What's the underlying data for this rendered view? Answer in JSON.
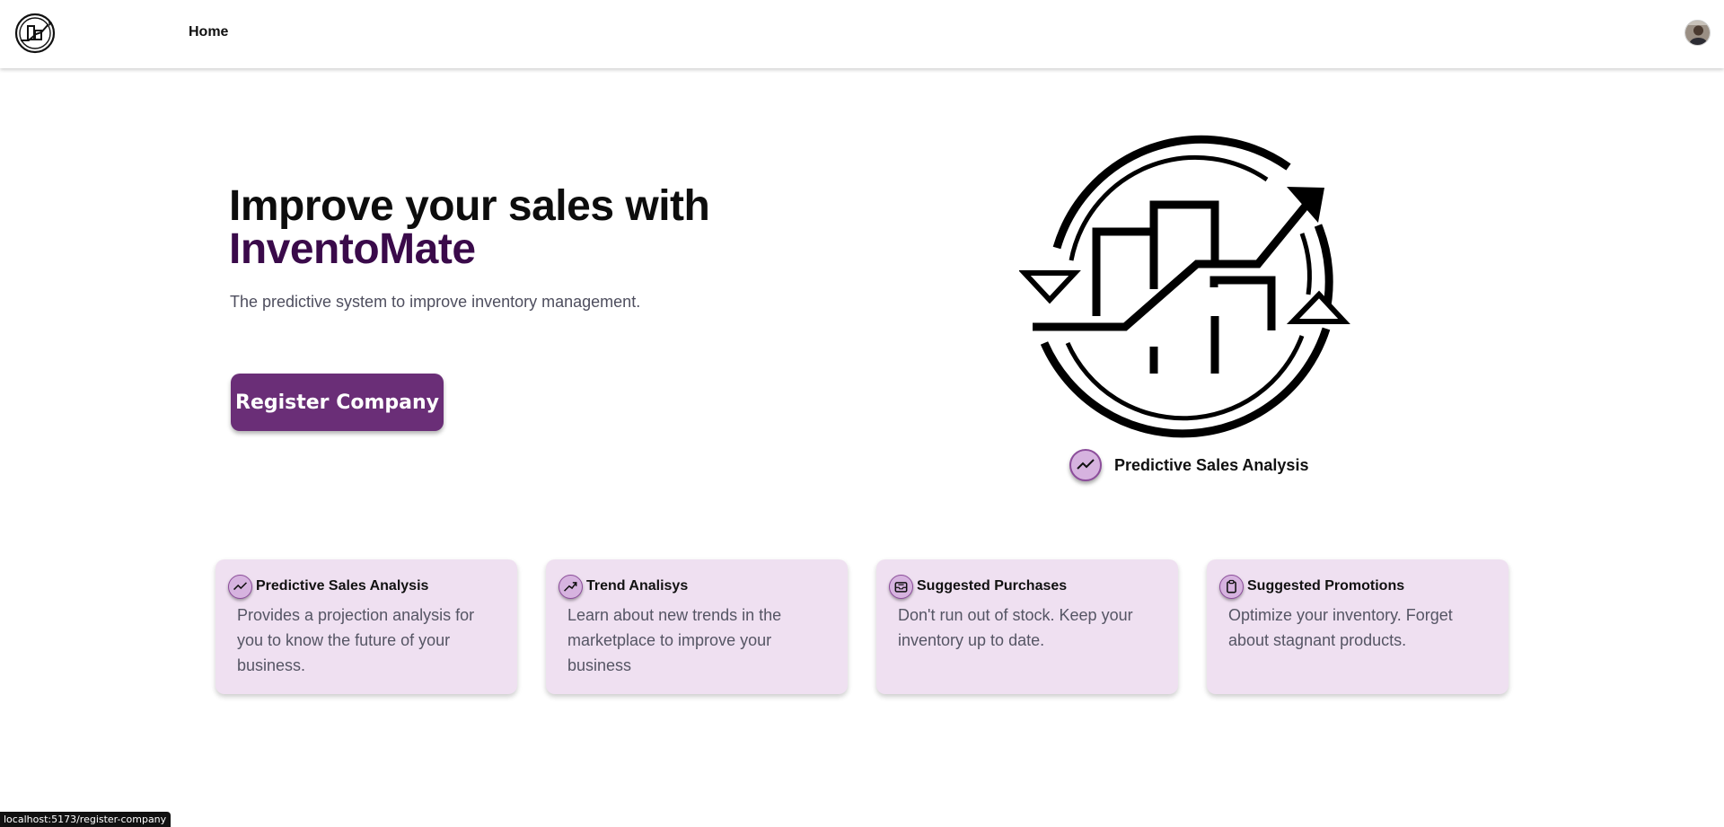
{
  "nav": {
    "logo_icon": "sales-circle-logo-icon",
    "home_label": "Home",
    "avatar_icon": "user-avatar-icon"
  },
  "hero": {
    "title_line1": "Improve your sales with",
    "title_line2": "InventoMate",
    "subtitle": "The predictive system to improve inventory management.",
    "register_label": "Register Company",
    "illustration_icon": "sales-growth-cycle-icon",
    "caption": "Predictive Sales Analysis",
    "caption_icon": "trend-line-icon"
  },
  "features": [
    {
      "icon": "trend-line-icon",
      "title": "Predictive Sales Analysis",
      "description": "Provides a projection analysis for you to know the future of your business."
    },
    {
      "icon": "trend-up-icon",
      "title": "Trend Analisys",
      "description": "Learn about new trends in the marketplace to improve your business"
    },
    {
      "icon": "inbox-icon",
      "title": "Suggested Purchases",
      "description": "Don't run out of stock. Keep your inventory up to date."
    },
    {
      "icon": "clipboard-icon",
      "title": "Suggested Promotions",
      "description": "Optimize your inventory. Forget about stagnant products."
    }
  ],
  "status_bar": {
    "url": "localhost:5173/register-company"
  },
  "colors": {
    "brand": "#3a0a4a",
    "button": "#6a2e77",
    "card_bg": "#efe0f1",
    "icon_bg": "#d6b3df"
  }
}
